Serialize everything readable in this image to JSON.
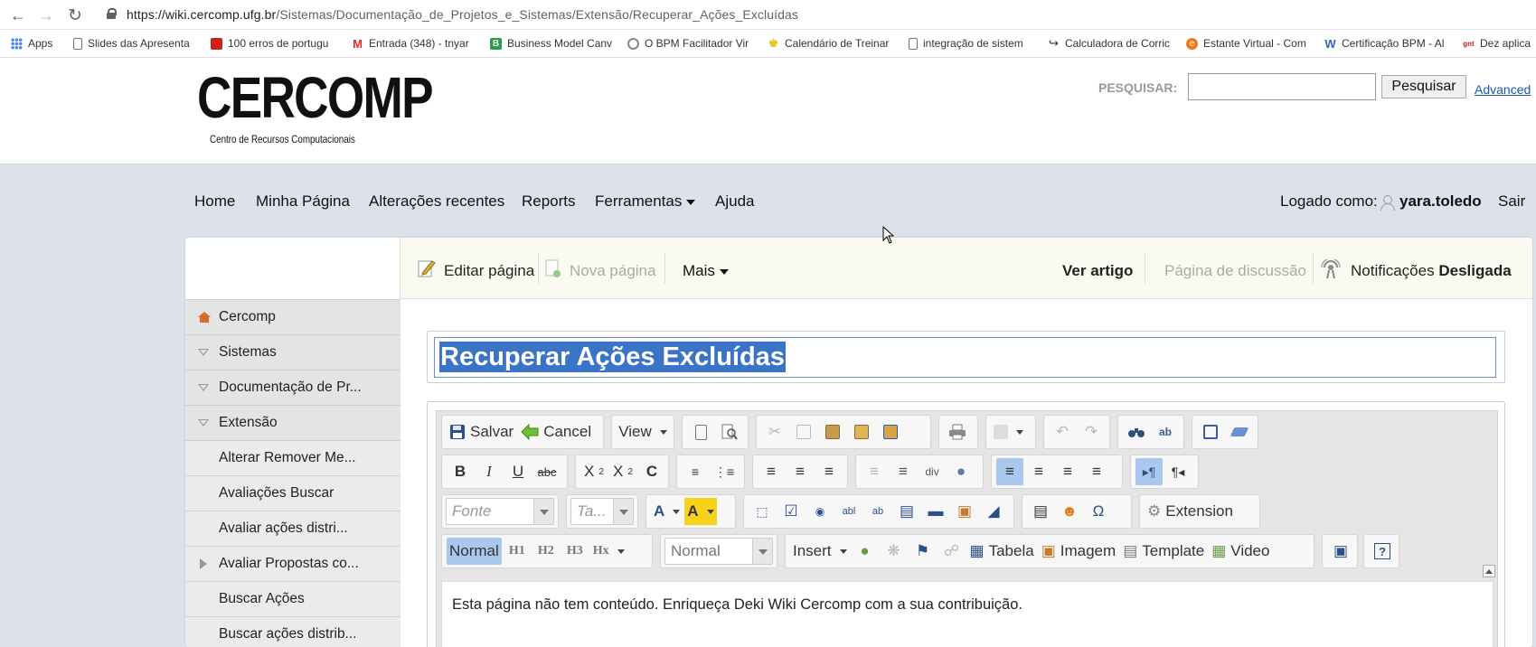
{
  "browser": {
    "url_host": "https://wiki.cercomp.ufg.br",
    "url_path": "/Sistemas/Documentação_de_Projetos_e_Sistemas/Extensão/Recuperar_Ações_Excluídas",
    "bookmarks": [
      {
        "label": "Apps",
        "icon": "apps-grid-icon",
        "color": "#4285f4"
      },
      {
        "label": "Slides das Apresenta",
        "icon": "page-icon",
        "color": "#777777"
      },
      {
        "label": "100 erros de portugu",
        "icon": "site-icon",
        "color": "#cc2222"
      },
      {
        "label": "Entrada (348) - tnyar",
        "icon": "gmail-icon",
        "color": "#d93025"
      },
      {
        "label": "Business Model Canv",
        "icon": "canvas-icon",
        "color": "#2a9d4a"
      },
      {
        "label": "O BPM Facilitador Vir",
        "icon": "bpm-icon",
        "color": "#888888"
      },
      {
        "label": "Calendário de Treinar",
        "icon": "crown-icon",
        "color": "#e6b800"
      },
      {
        "label": "integração de sistem",
        "icon": "page-icon",
        "color": "#777777"
      },
      {
        "label": "Calculadora de Corric",
        "icon": "runner-icon",
        "color": "#111111"
      },
      {
        "label": "Estante Virtual - Com",
        "icon": "estante-icon",
        "color": "#f07a1a"
      },
      {
        "label": "Certificação BPM - Al",
        "icon": "w-icon",
        "color": "#3b5fc0"
      },
      {
        "label": "Dez aplica",
        "icon": "gnt-icon",
        "color": "#c02020"
      }
    ]
  },
  "header": {
    "logo_text": "CERCOMP",
    "logo_subtitle": "Centro de Recursos Computacionais",
    "search_label": "PESQUISAR:",
    "search_value": "",
    "search_button": "Pesquisar",
    "advanced_link": "Advanced"
  },
  "nav": {
    "items": [
      "Home",
      "Minha Página",
      "Alterações recentes",
      "Reports",
      "Ferramentas",
      "Ajuda"
    ],
    "login_label": "Logado como:",
    "username": "yara.toledo",
    "logout": "Sair"
  },
  "sidebar": {
    "items": [
      {
        "label": "Cercomp",
        "icon": "home-icon"
      },
      {
        "label": "Sistemas",
        "icon": "expand-down-icon"
      },
      {
        "label": "Documentação de Pr...",
        "icon": "expand-down-icon"
      },
      {
        "label": "Extensão",
        "icon": "expand-down-icon"
      },
      {
        "label": "Alterar Remover Me...",
        "icon": ""
      },
      {
        "label": "Avaliações Buscar",
        "icon": ""
      },
      {
        "label": "Avaliar ações distri...",
        "icon": ""
      },
      {
        "label": "Avaliar Propostas co...",
        "icon": "expand-right-icon"
      },
      {
        "label": "Buscar Ações",
        "icon": ""
      },
      {
        "label": "Buscar ações distrib...",
        "icon": ""
      }
    ]
  },
  "page_toolbar": {
    "edit": "Editar página",
    "new_page": "Nova página",
    "more": "Mais",
    "view_article": "Ver artigo",
    "discussion": "Página de discussão",
    "notifications_label": "Notificações",
    "notifications_state": "Desligada"
  },
  "editor": {
    "title": "Recuperar Ações Excluídas",
    "save": "Salvar",
    "cancel": "Cancel",
    "view": "View",
    "font_placeholder": "Fonte",
    "size_placeholder": "Ta...",
    "extension": "Extension",
    "format_normal": "Normal",
    "headings": [
      "H1",
      "H2",
      "H3",
      "Hx"
    ],
    "style_value": "Normal",
    "insert": "Insert",
    "table": "Tabela",
    "image": "Imagem",
    "template": "Template",
    "video": "Video",
    "body_text": "Esta página não tem conteúdo. Enriqueça Deki Wiki Cercomp com a sua contribuição."
  }
}
